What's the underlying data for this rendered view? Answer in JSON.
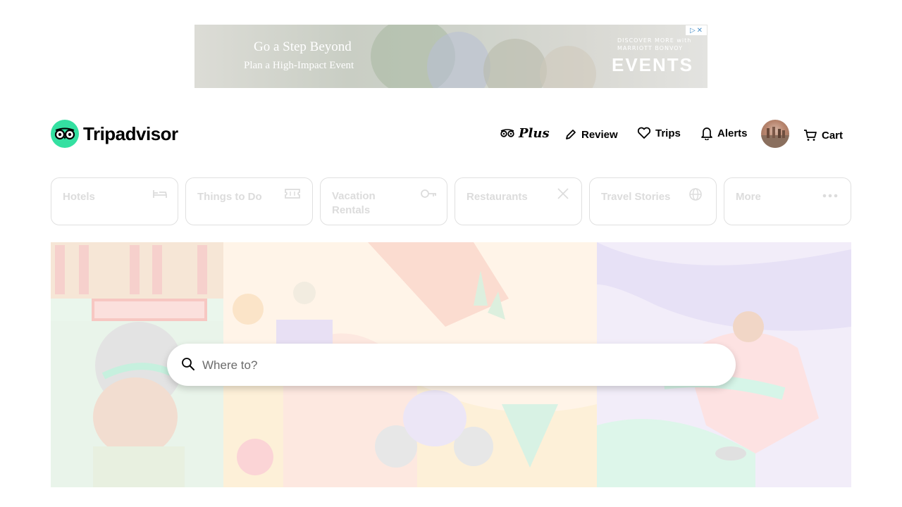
{
  "ad": {
    "headline": "Go a Step Beyond",
    "subline": "Plan a High-Impact Event",
    "brand_line1": "DISCOVER MORE with",
    "brand_line2": "MARRIOTT BONVOY",
    "events_label": "EVENTS"
  },
  "header": {
    "logo_text": "Tripadvisor",
    "plus_label": "Plus",
    "review_label": "Review",
    "trips_label": "Trips",
    "alerts_label": "Alerts",
    "cart_label": "Cart"
  },
  "nav": {
    "hotels": "Hotels",
    "things_to_do": "Things to Do",
    "vacation_rentals_line1": "Vacation",
    "vacation_rentals_line2": "Rentals",
    "restaurants": "Restaurants",
    "travel_stories": "Travel Stories",
    "more": "More"
  },
  "search": {
    "placeholder": "Where to?"
  },
  "colors": {
    "brand": "#34e0a1",
    "nav_text": "#dcdcdc"
  }
}
